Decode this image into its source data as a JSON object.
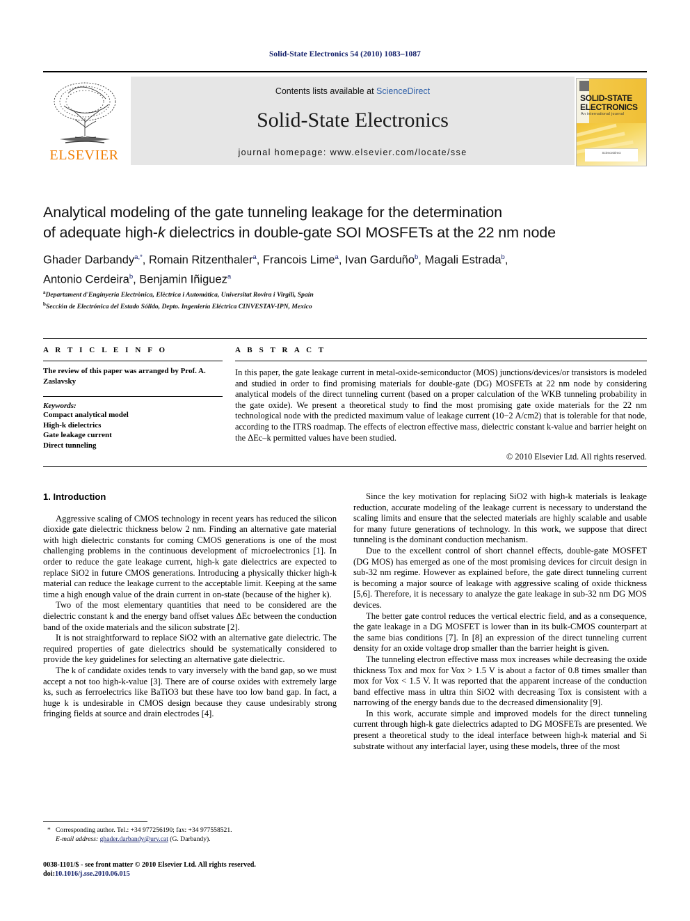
{
  "running_head": "Solid-State Electronics 54 (2010) 1083–1087",
  "masthead": {
    "publisher_name": "ELSEVIER",
    "contents_line_prefix": "Contents lists available at ",
    "contents_link": "ScienceDirect",
    "journal_title": "Solid-State Electronics",
    "homepage": "journal homepage: www.elsevier.com/locate/sse",
    "cover": {
      "line1": "SOLID-STATE",
      "line2": "ELECTRONICS",
      "subtitle": "An international journal",
      "footer": "ScienceDirect"
    },
    "link_color": "#2d5fa8",
    "banner_bg": "#e6e6e6",
    "elsevier_orange": "#f07d00"
  },
  "article": {
    "title_line1": "Analytical modeling of the gate tunneling leakage for the determination",
    "title_line2_a": "of adequate high-",
    "title_line2_k": "k",
    "title_line2_b": " dielectrics in double-gate SOI MOSFETs at the 22 nm node",
    "authors": [
      {
        "name": "Ghader Darbandy",
        "sup": "a,*"
      },
      {
        "name": "Romain Ritzenthaler",
        "sup": "a"
      },
      {
        "name": "Francois Lime",
        "sup": "a"
      },
      {
        "name": "Ivan Garduño",
        "sup": "b"
      },
      {
        "name": "Magali Estrada",
        "sup": "b"
      },
      {
        "name": "Antonio Cerdeira",
        "sup": "b"
      },
      {
        "name": "Benjamin Iñiguez",
        "sup": "a"
      }
    ],
    "affiliations": [
      {
        "marker": "a",
        "text": "Departament d'Enginyeria Electrònica, Elèctrica i Automàtica, Universitat Rovira i Virgili, Spain"
      },
      {
        "marker": "b",
        "text": "Sección de Electrónica del Estado Sólido, Depto. Ingeniería Eléctrica CINVESTAV-IPN, Mexico"
      }
    ]
  },
  "article_info": {
    "heading": "A R T I C L E   I N F O",
    "history": "The review of this paper was arranged by Prof. A. Zaslavsky",
    "keywords_label": "Keywords:",
    "keywords": [
      "Compact analytical model",
      "High-k dielectrics",
      "Gate leakage current",
      "Direct tunneling"
    ]
  },
  "abstract": {
    "heading": "A B S T R A C T",
    "paragraph": "In this paper, the gate leakage current in metal-oxide-semiconductor (MOS) junctions/devices/or transistors is modeled and studied in order to find promising materials for double-gate (DG) MOSFETs at 22 nm node by considering analytical models of the direct tunneling current (based on a proper calculation of the WKB tunneling probability in the gate oxide). We present a theoretical study to find the most promising gate oxide materials for the 22 nm technological node with the predicted maximum value of leakage current (10−2 A/cm2) that is tolerable for that node, according to the ITRS roadmap. The effects of electron effective mass, dielectric constant k-value and barrier height on the ΔEc–k permitted values have been studied.",
    "copyright": "© 2010 Elsevier Ltd. All rights reserved."
  },
  "sections": {
    "intro_heading": "1. Introduction"
  },
  "left_column": {
    "p1": "Aggressive scaling of CMOS technology in recent years has reduced the silicon dioxide gate dielectric thickness below 2 nm. Finding an alternative gate material with high dielectric constants for coming CMOS generations is one of the most challenging problems in the continuous development of microelectronics [1]. In order to reduce the gate leakage current, high-k gate dielectrics are expected to replace SiO2 in future CMOS generations. Introducing a physically thicker high-k material can reduce the leakage current to the acceptable limit. Keeping at the same time a high enough value of the drain current in on-state (because of the higher k).",
    "p2": "Two of the most elementary quantities that need to be considered are the dielectric constant k and the energy band offset values ΔEc between the conduction band of the oxide materials and the silicon substrate [2].",
    "p3": "It is not straightforward to replace SiO2 with an alternative gate dielectric. The required properties of gate dielectrics should be systematically considered to provide the key guidelines for selecting an alternative gate dielectric.",
    "p4": "The k of candidate oxides tends to vary inversely with the band gap, so we must accept a not too high-k-value [3]. There are of course oxides with extremely large ks, such as ferroelectrics like BaTiO3 but these have too low band gap. In fact, a huge k is undesirable in CMOS design because they cause undesirably strong fringing fields at source and drain electrodes [4]."
  },
  "right_column": {
    "p1": "Since the key motivation for replacing SiO2 with high-k materials is leakage reduction, accurate modeling of the leakage current is necessary to understand the scaling limits and ensure that the selected materials are highly scalable and usable for many future generations of technology. In this work, we suppose that direct tunneling is the dominant conduction mechanism.",
    "p2": "Due to the excellent control of short channel effects, double-gate MOSFET (DG MOS) has emerged as one of the most promising devices for circuit design in sub-32 nm regime. However as explained before, the gate direct tunneling current is becoming a major source of leakage with aggressive scaling of oxide thickness [5,6]. Therefore, it is necessary to analyze the gate leakage in sub-32 nm DG MOS devices.",
    "p3": "The better gate control reduces the vertical electric field, and as a consequence, the gate leakage in a DG MOSFET is lower than in its bulk-CMOS counterpart at the same bias conditions [7]. In [8] an expression of the direct tunneling current density for an oxide voltage drop smaller than the barrier height is given.",
    "p4": "The tunneling electron effective mass mox increases while decreasing the oxide thickness Tox and mox for Vox > 1.5 V is about a factor of 0.8 times smaller than mox for Vox < 1.5 V. It was reported that the apparent increase of the conduction band effective mass in ultra thin SiO2 with decreasing Tox is consistent with a narrowing of the energy bands due to the decreased dimensionality [9].",
    "p5": "In this work, accurate simple and improved models for the direct tunneling current through high-k gate dielectrics adapted to DG MOSFETs are presented. We present a theoretical study to the ideal interface between high-k material and Si substrate without any interfacial layer, using these models, three of the most"
  },
  "footnotes": {
    "corresponding": "Corresponding author. Tel.: +34 977256190; fax: +34 977558521.",
    "email_label": "E-mail address:",
    "email": "ghader.darbandy@urv.cat",
    "email_suffix": "(G. Darbandy).",
    "issn_line": "0038-1101/$ - see front matter © 2010 Elsevier Ltd. All rights reserved.",
    "doi_label": "doi:",
    "doi": "10.1016/j.sse.2010.06.015"
  }
}
